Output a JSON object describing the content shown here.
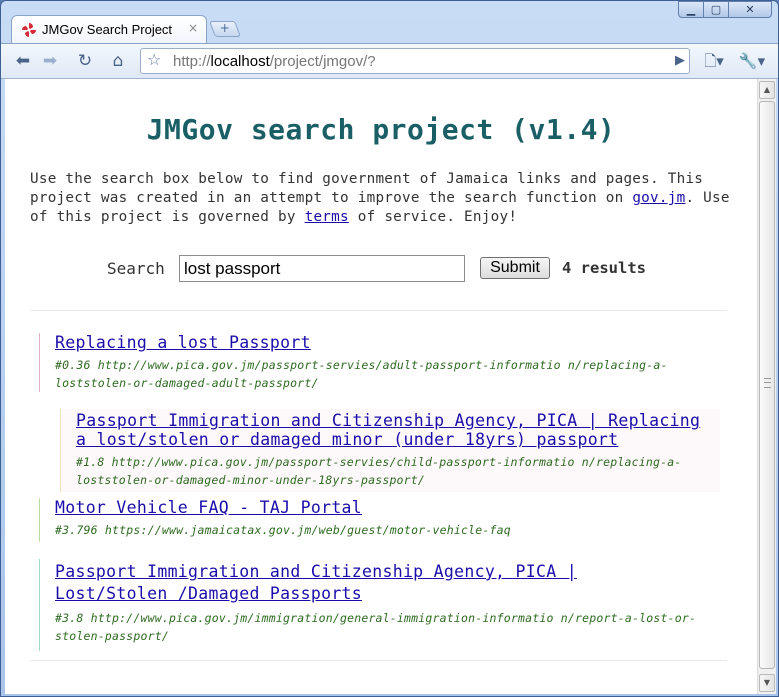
{
  "browser": {
    "tab_title": "JMGov Search Project",
    "tab_close": "×",
    "new_tab": "+",
    "window_buttons": [
      "▁",
      "▢",
      "✕"
    ],
    "url_scheme": "http://",
    "url_host": "localhost",
    "url_path": "/project/jmgov/?",
    "icons": [
      "back-icon",
      "forward-icon",
      "reload-icon",
      "home-icon",
      "star-icon",
      "go-icon",
      "page-menu-icon",
      "wrench-icon"
    ]
  },
  "page": {
    "heading": "JMGov search project (v1.4)",
    "intro_1": "Use the search box below to find government of Jamaica links and pages. This project was created in an attempt to improve the search function on ",
    "intro_link_1": "gov.jm",
    "intro_2": ". Use of this project is governed by ",
    "intro_link_2": "terms",
    "intro_3": " of service. Enjoy!",
    "search_label": "Search",
    "search_value": "lost passport",
    "submit_label": "Submit",
    "result_count": "4 results"
  },
  "results": [
    {
      "title": "Replacing a lost Passport",
      "meta": "#0.36 http://www.pica.gov.jm/passport-servies/adult-passport-informatio n/replacing-a-loststolen-or-damaged-adult-passport/",
      "border_color": "#e0b0c8"
    },
    {
      "title": "Passport Immigration and Citizenship Agency, PICA | Replacing a lost/stolen or damaged minor (under 18yrs) passport",
      "meta": "#1.8 http://www.pica.gov.jm/passport-servies/child-passport-informatio n/replacing-a-loststolen-or-damaged-minor-under-18yrs-passport/",
      "border_color": "#f0e2b8"
    },
    {
      "title": "Motor Vehicle FAQ - TAJ Portal",
      "meta": "#3.796 https://www.jamaicatax.gov.jm/web/guest/motor-vehicle-faq",
      "border_color": "#b8dca0"
    },
    {
      "title": "Passport Immigration and Citizenship Agency, PICA | Lost/Stolen /Damaged Passports",
      "meta": "#3.8 http://www.pica.gov.jm/immigration/general-immigration-informatio n/report-a-lost-or-stolen-passport/",
      "border_color": "#9ed8c8"
    }
  ]
}
